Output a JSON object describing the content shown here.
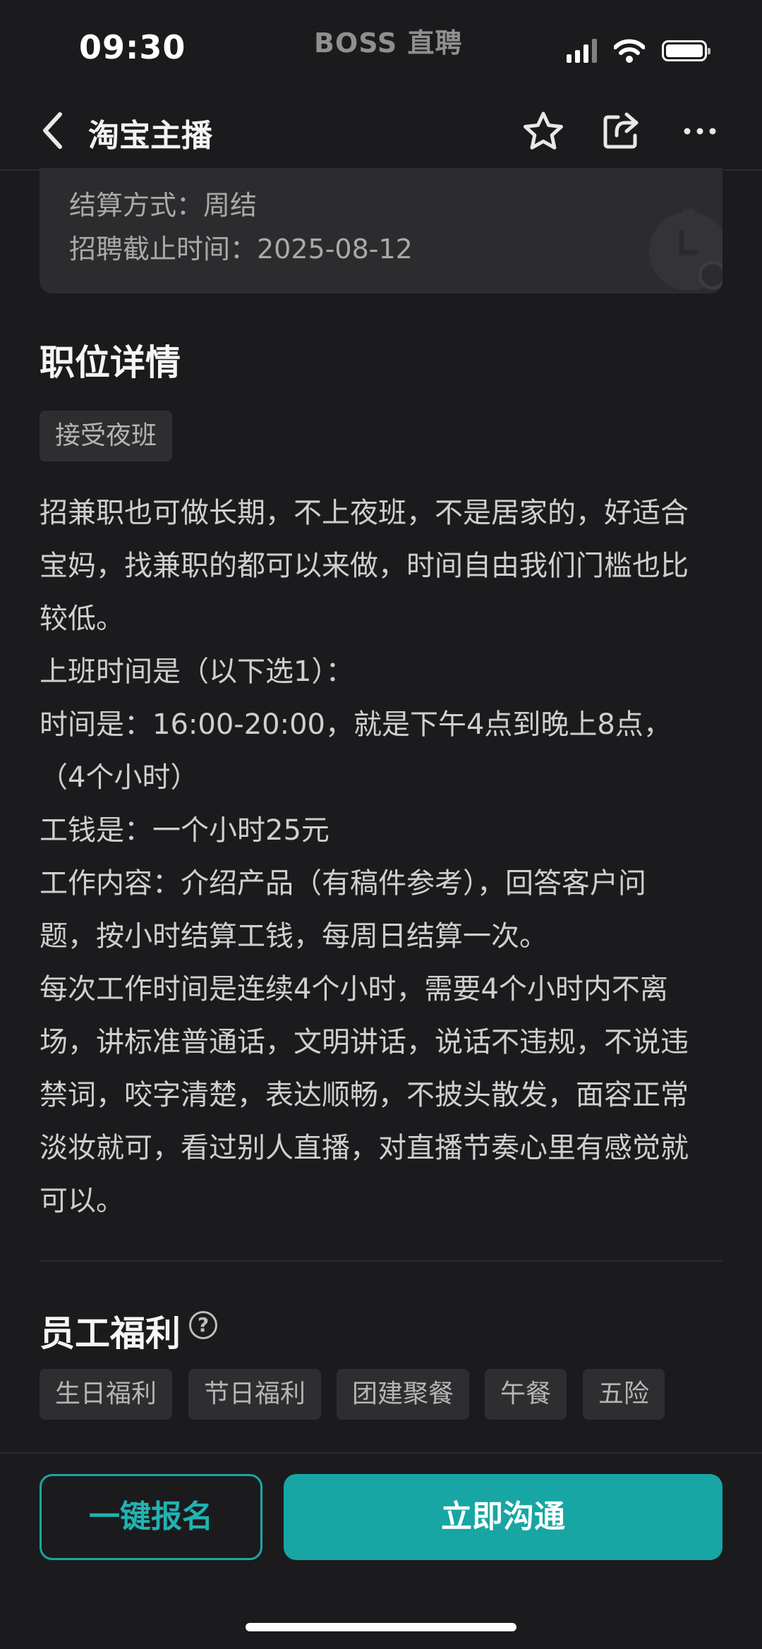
{
  "status_bar": {
    "time": "09:30",
    "watermark": "BOSS 直聘",
    "icons": [
      "signal-icon",
      "wifi-icon",
      "battery-icon"
    ]
  },
  "nav": {
    "title": "淘宝主播",
    "icons": [
      "back-icon",
      "star-icon",
      "share-icon",
      "more-icon"
    ]
  },
  "info_card": {
    "settlement": "结算方式：周结",
    "deadline": "招聘截止时间：2025-08-12"
  },
  "job_detail": {
    "title": "职位详情",
    "tags": [
      "接受夜班"
    ],
    "description_lines": [
      "招兼职也可做长期，不上夜班，不是居家的，好适合",
      "宝妈，找兼职的都可以来做，时间自由我们门槛也比",
      "较低。",
      "上班时间是（以下选1）：",
      "时间是：16:00-20:00，就是下午4点到晚上8点，",
      "（4个小时）",
      "工钱是：一个小时25元",
      "工作内容：介绍产品（有稿件参考），回答客户问",
      "题，按小时结算工钱，每周日结算一次。",
      "每次工作时间是连续4个小时，需要4个小时内不离",
      "场，讲标准普通话，文明讲话，说话不违规，不说违",
      "禁词，咬字清楚，表达顺畅，不披头散发，面容正常",
      "淡妆就可，看过别人直播，对直播节奏心里有感觉就",
      "可以。"
    ]
  },
  "benefits": {
    "title": "员工福利",
    "help_glyph": "?",
    "tags": [
      "生日福利",
      "节日福利",
      "团建聚餐",
      "午餐",
      "五险"
    ]
  },
  "actions": {
    "quick_apply": "一键报名",
    "chat_now": "立即沟通"
  },
  "colors": {
    "background": "#1b1b1d",
    "accent": "#17a6a4",
    "card": "#2c2c2e"
  }
}
